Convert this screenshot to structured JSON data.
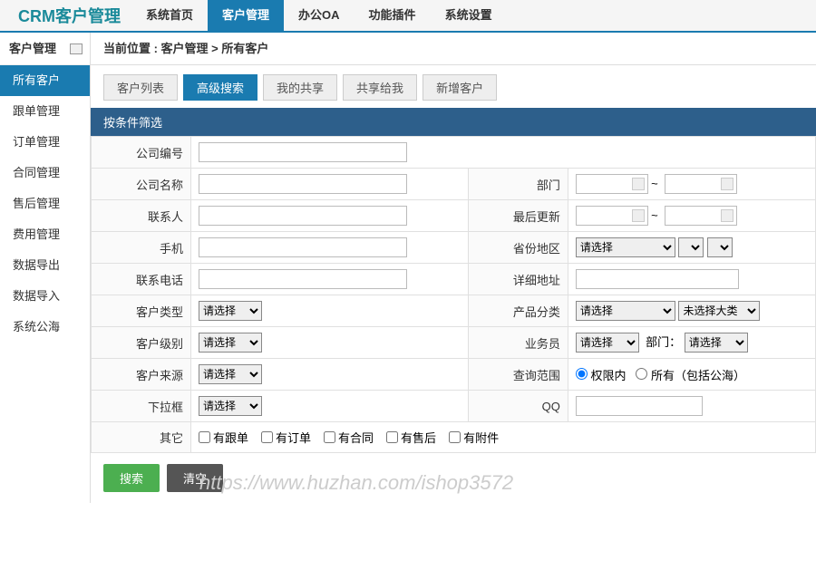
{
  "brand": "CRM客户管理",
  "topnav": [
    {
      "label": "系统首页",
      "active": false
    },
    {
      "label": "客户管理",
      "active": true
    },
    {
      "label": "办公OA",
      "active": false
    },
    {
      "label": "功能插件",
      "active": false
    },
    {
      "label": "系统设置",
      "active": false
    }
  ],
  "sidebar": {
    "header": "客户管理",
    "items": [
      {
        "label": "所有客户",
        "active": true
      },
      {
        "label": "跟单管理",
        "active": false
      },
      {
        "label": "订单管理",
        "active": false
      },
      {
        "label": "合同管理",
        "active": false
      },
      {
        "label": "售后管理",
        "active": false
      },
      {
        "label": "费用管理",
        "active": false
      },
      {
        "label": "数据导出",
        "active": false
      },
      {
        "label": "数据导入",
        "active": false
      },
      {
        "label": "系统公海",
        "active": false
      }
    ]
  },
  "breadcrumb": "当前位置 : 客户管理 > 所有客户",
  "tabs": [
    {
      "label": "客户列表",
      "active": false
    },
    {
      "label": "高级搜索",
      "active": true
    },
    {
      "label": "我的共享",
      "active": false
    },
    {
      "label": "共享给我",
      "active": false
    },
    {
      "label": "新增客户",
      "active": false
    }
  ],
  "filter": {
    "header": "按条件筛选",
    "labels": {
      "company_no": "公司编号",
      "company_name": "公司名称",
      "contact": "联系人",
      "mobile": "手机",
      "phone": "联系电话",
      "cust_type": "客户类型",
      "cust_level": "客户级别",
      "cust_source": "客户来源",
      "dropdown": "下拉框",
      "other": "其它",
      "dept": "部门",
      "last_update": "最后更新",
      "province": "省份地区",
      "address": "详细地址",
      "prod_cat": "产品分类",
      "salesman": "业务员",
      "scope": "查询范围",
      "qq": "QQ"
    },
    "select_placeholder": "请选择",
    "select_big_cat": "未选择大类",
    "dept_label_inline": "部门：",
    "date_sep": "~",
    "scope_options": {
      "perm": "权限内",
      "all": "所有（包括公海）"
    },
    "checkboxes": [
      "有跟单",
      "有订单",
      "有合同",
      "有售后",
      "有附件"
    ]
  },
  "buttons": {
    "search": "搜索",
    "clear": "清空"
  },
  "watermark": "https://www.huzhan.com/ishop3572"
}
